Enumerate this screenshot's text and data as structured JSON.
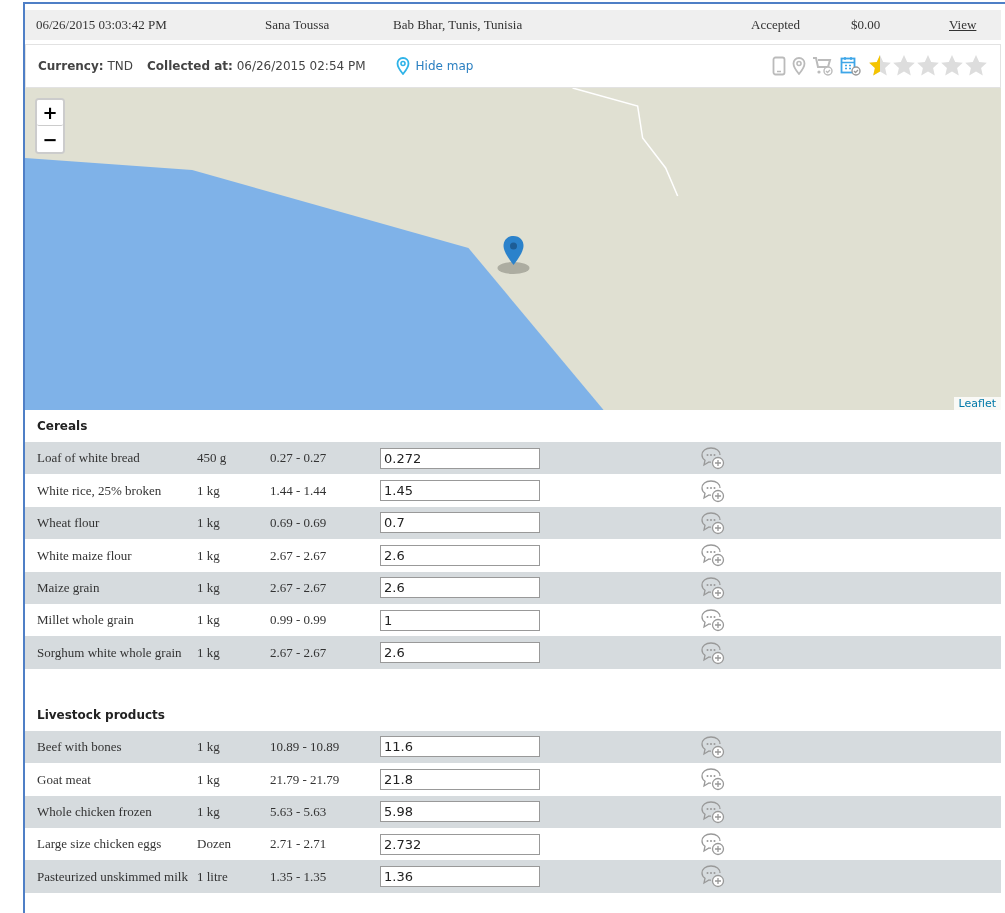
{
  "submission": {
    "date": "06/26/2015 03:03:42 PM",
    "collector": "Sana Toussa",
    "location": "Bab Bhar, Tunis, Tunisia",
    "status": "Accepted",
    "amount": "$0.00",
    "link": "View"
  },
  "details": {
    "currency_label": "Currency:",
    "currency": "TND",
    "collected_label": "Collected at:",
    "collected": "06/26/2015 02:54 PM",
    "map_toggle": "Hide map",
    "indicators": [
      {
        "kind": "phone",
        "active": false
      },
      {
        "kind": "pin",
        "active": false
      },
      {
        "kind": "cart",
        "active": false
      },
      {
        "kind": "calendar",
        "active": true
      }
    ],
    "stars": 0.5
  },
  "map": {
    "zoom_in": "+",
    "zoom_out": "−",
    "attribution": "Leaflet"
  },
  "sections": [
    {
      "title": "Cereals",
      "rows": [
        {
          "name": "Loaf of white bread",
          "unit": "450 g",
          "range": "0.27 - 0.27",
          "value": "0.272"
        },
        {
          "name": "White rice, 25% broken",
          "unit": "1 kg",
          "range": "1.44 - 1.44",
          "value": "1.45"
        },
        {
          "name": "Wheat flour",
          "unit": "1 kg",
          "range": "0.69 - 0.69",
          "value": "0.7"
        },
        {
          "name": "White maize flour",
          "unit": "1 kg",
          "range": "2.67 - 2.67",
          "value": "2.6"
        },
        {
          "name": "Maize grain",
          "unit": "1 kg",
          "range": "2.67 - 2.67",
          "value": "2.6"
        },
        {
          "name": "Millet whole grain",
          "unit": "1 kg",
          "range": "0.99 - 0.99",
          "value": "1"
        },
        {
          "name": "Sorghum white whole grain",
          "unit": "1 kg",
          "range": "2.67 - 2.67",
          "value": "2.6"
        }
      ]
    },
    {
      "title": "Livestock products",
      "rows": [
        {
          "name": "Beef with bones",
          "unit": "1 kg",
          "range": "10.89 - 10.89",
          "value": "11.6"
        },
        {
          "name": "Goat meat",
          "unit": "1 kg",
          "range": "21.79 - 21.79",
          "value": "21.8"
        },
        {
          "name": "Whole chicken frozen",
          "unit": "1 kg",
          "range": "5.63 - 5.63",
          "value": "5.98"
        },
        {
          "name": "Large size chicken eggs",
          "unit": "Dozen",
          "range": "2.71 - 2.71",
          "value": "2.732"
        },
        {
          "name": "Pasteurized unskimmed milk",
          "unit": "1 litre",
          "range": "1.35 - 1.35",
          "value": "1.36"
        }
      ]
    }
  ]
}
